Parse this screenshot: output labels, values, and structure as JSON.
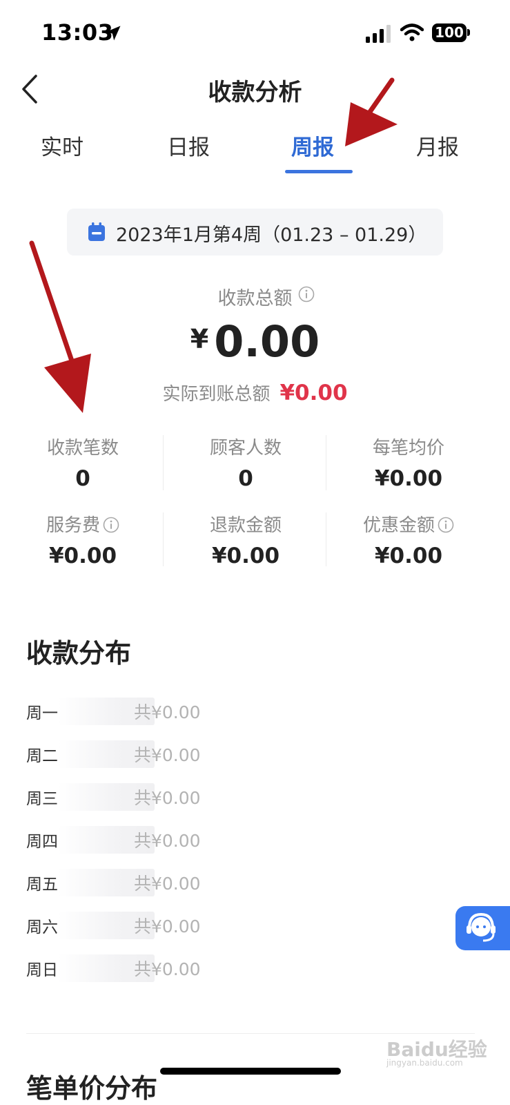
{
  "status_bar": {
    "time": "13:03",
    "battery": "100"
  },
  "header": {
    "title": "收款分析"
  },
  "tabs": [
    {
      "label": "实时",
      "active": false
    },
    {
      "label": "日报",
      "active": false
    },
    {
      "label": "周报",
      "active": true
    },
    {
      "label": "月报",
      "active": false
    }
  ],
  "date_range": "2023年1月第4周（01.23 – 01.29）",
  "total": {
    "label": "收款总额",
    "currency": "¥",
    "amount": "0.00",
    "arrived_label": "实际到账总额",
    "arrived_value": "¥0.00"
  },
  "stats": [
    {
      "label": "收款笔数",
      "value": "0",
      "info": false
    },
    {
      "label": "顾客人数",
      "value": "0",
      "info": false
    },
    {
      "label": "每笔均价",
      "value": "¥0.00",
      "info": false
    },
    {
      "label": "服务费",
      "value": "¥0.00",
      "info": true
    },
    {
      "label": "退款金额",
      "value": "¥0.00",
      "info": false
    },
    {
      "label": "优惠金额",
      "value": "¥0.00",
      "info": true
    }
  ],
  "distribution": {
    "title": "收款分布",
    "rows": [
      {
        "day": "周一",
        "sum": "共¥0.00"
      },
      {
        "day": "周二",
        "sum": "共¥0.00"
      },
      {
        "day": "周三",
        "sum": "共¥0.00"
      },
      {
        "day": "周四",
        "sum": "共¥0.00"
      },
      {
        "day": "周五",
        "sum": "共¥0.00"
      },
      {
        "day": "周六",
        "sum": "共¥0.00"
      },
      {
        "day": "周日",
        "sum": "共¥0.00"
      }
    ]
  },
  "next_section": {
    "title": "笔单价分布"
  },
  "watermark": {
    "text": "Baidu经验",
    "sub": "jingyan.baidu.com"
  },
  "colors": {
    "accent": "#3b74df",
    "red": "#e0344a",
    "arrow": "#b3181c"
  }
}
